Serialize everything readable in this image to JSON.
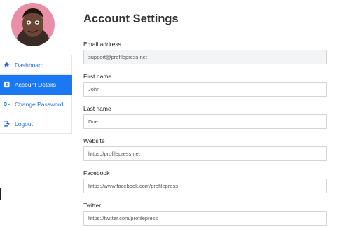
{
  "nav": {
    "items": [
      {
        "label": "Dashboard",
        "icon": "home-icon",
        "active": false
      },
      {
        "label": "Account Details",
        "icon": "id-card-icon",
        "active": true
      },
      {
        "label": "Change Password",
        "icon": "key-icon",
        "active": false
      },
      {
        "label": "Logout",
        "icon": "logout-icon",
        "active": false
      }
    ]
  },
  "main": {
    "title": "Account Settings",
    "fields": [
      {
        "label": "Email address",
        "value": "support@profilepress.net"
      },
      {
        "label": "First name",
        "value": "John"
      },
      {
        "label": "Last name",
        "value": "Doe"
      },
      {
        "label": "Website",
        "value": "https://profilepress.net"
      },
      {
        "label": "Facebook",
        "value": "https://www.facebook.com/profilepress"
      },
      {
        "label": "Twitter",
        "value": "https://twitter.com/profilepress"
      }
    ]
  },
  "colors": {
    "accent": "#1a78f2",
    "link": "#2a6fdb",
    "border": "#e6e6e6",
    "input_fill": "#f3f4f6"
  }
}
